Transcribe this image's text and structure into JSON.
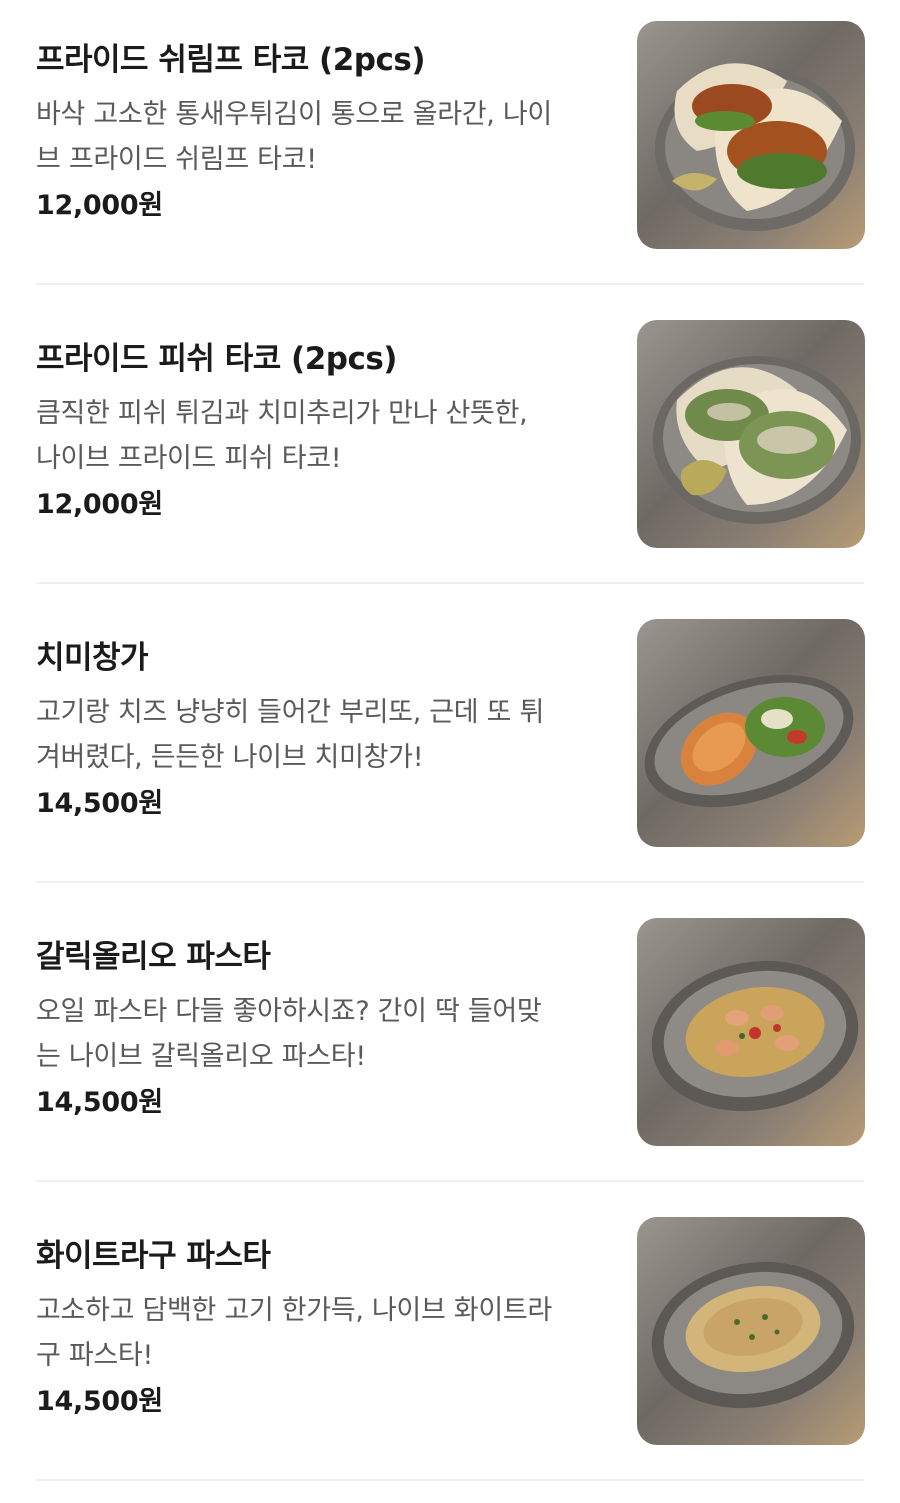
{
  "menu": {
    "items": [
      {
        "name": "프라이드 쉬림프 타코 (2pcs)",
        "desc_line1": "바삭 고소한 통새우튀김이 통으로 올라간, 나이",
        "desc_line2": "브 프라이드 쉬림프 타코!",
        "price": "12,000원",
        "image_icon": "shrimp-taco-photo"
      },
      {
        "name": "프라이드 피쉬 타코 (2pcs)",
        "desc_line1": "큼직한 피쉬 튀김과 치미추리가 만나 산뜻한,",
        "desc_line2": "나이브 프라이드 피쉬 타코!",
        "price": "12,000원",
        "image_icon": "fish-taco-photo"
      },
      {
        "name": "치미창가",
        "desc_line1": "고기랑 치즈 냥냥히 들어간 부리또, 근데 또 튀",
        "desc_line2": "겨버렸다, 든든한 나이브 치미창가!",
        "price": "14,500원",
        "image_icon": "chimichanga-photo"
      },
      {
        "name": "갈릭올리오 파스타",
        "desc_line1": "오일 파스타 다들 좋아하시죠? 간이 딱 들어맞",
        "desc_line2": "는 나이브 갈릭올리오 파스타!",
        "price": "14,500원",
        "image_icon": "garlic-olio-pasta-photo"
      },
      {
        "name": "화이트라구 파스타",
        "desc_line1": "고소하고 담백한 고기 한가득, 나이브 화이트라",
        "desc_line2": "구 파스타!",
        "price": "14,500원",
        "image_icon": "white-ragu-pasta-photo"
      }
    ]
  },
  "colors": {
    "title": "#1b1b1b",
    "description": "#5a5a5a",
    "price": "#1b1b1b",
    "divider": "#f0f0f0",
    "background": "#ffffff"
  }
}
